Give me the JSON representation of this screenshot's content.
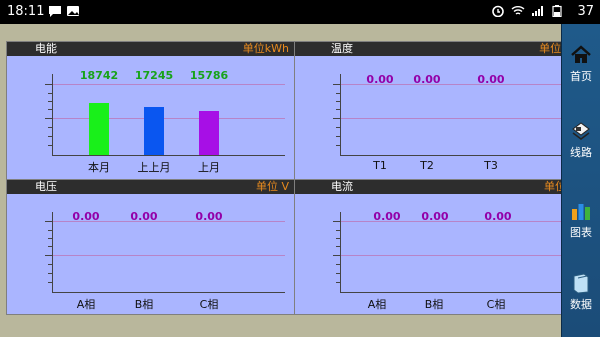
{
  "status_bar": {
    "time": "18:11",
    "battery": "37",
    "left_icons": [
      "message-icon",
      "image-icon"
    ],
    "right_icons": [
      "alarm-icon",
      "wifi-icon",
      "signal-icon",
      "battery-icon"
    ]
  },
  "panels": {
    "energy": {
      "title": "电能",
      "unit": "单位kWh",
      "categories": [
        "本月",
        "上上月",
        "上月"
      ],
      "values": [
        "18742",
        "17245",
        "15786"
      ],
      "value_color": "#18a31a",
      "bar_colors": [
        "#19f01a",
        "#0a56f0",
        "#a70fe6"
      ],
      "bar_levels": [
        18742,
        17245,
        15786
      ]
    },
    "temperature": {
      "title": "温度",
      "unit": "单位 ℃",
      "categories": [
        "T1",
        "T2",
        "T3"
      ],
      "values": [
        "0.00",
        "0.00",
        "0.00"
      ],
      "value_color": "#9300a8"
    },
    "voltage": {
      "title": "电压",
      "unit": "单位 V",
      "categories": [
        "A相",
        "B相",
        "C相"
      ],
      "values": [
        "0.00",
        "0.00",
        "0.00"
      ],
      "value_color": "#9300a8"
    },
    "current": {
      "title": "电流",
      "unit": "单位 A",
      "categories": [
        "A相",
        "B相",
        "C相"
      ],
      "values": [
        "0.00",
        "0.00",
        "0.00"
      ],
      "value_color": "#9300a8"
    }
  },
  "sidebar": {
    "items": [
      {
        "label": "首页",
        "icon": "home-icon"
      },
      {
        "label": "线路",
        "icon": "circuit-icon"
      },
      {
        "label": "图表",
        "icon": "chart-icon"
      },
      {
        "label": "数据",
        "icon": "book-icon"
      }
    ]
  }
}
